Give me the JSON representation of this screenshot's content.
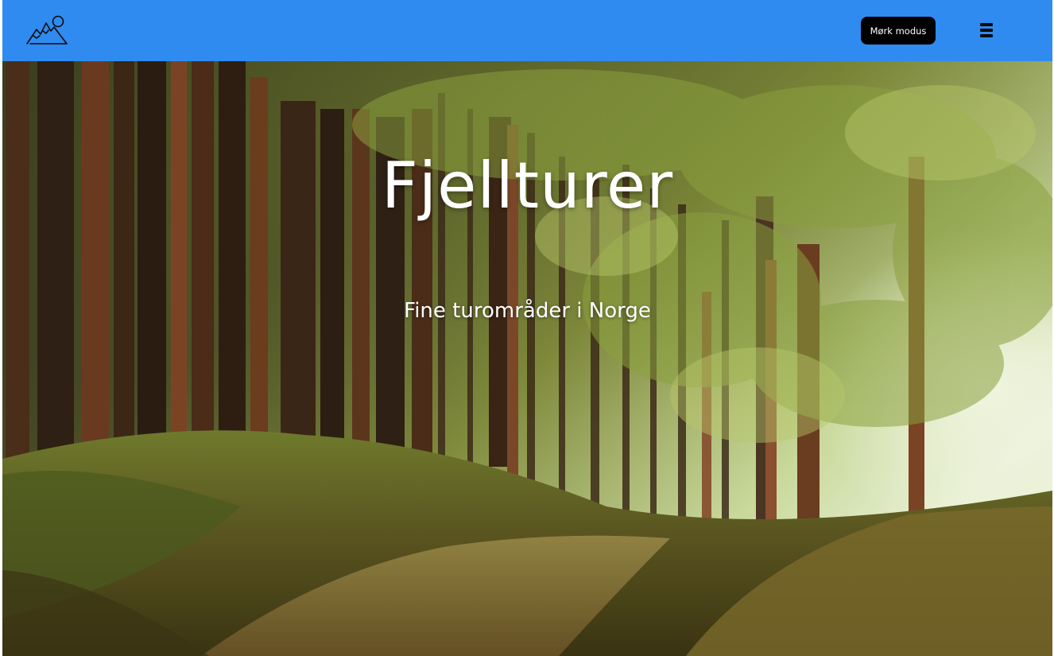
{
  "header": {
    "logo_icon": "mountains-logo-icon",
    "dark_mode_label": "Mørk modus",
    "menu_icon": "hamburger-menu-icon",
    "background_color": "#2f8bf0"
  },
  "hero": {
    "title": "Fjellturer",
    "subtitle": "Fine turområder i Norge",
    "background_image": "forest-path-photo"
  }
}
